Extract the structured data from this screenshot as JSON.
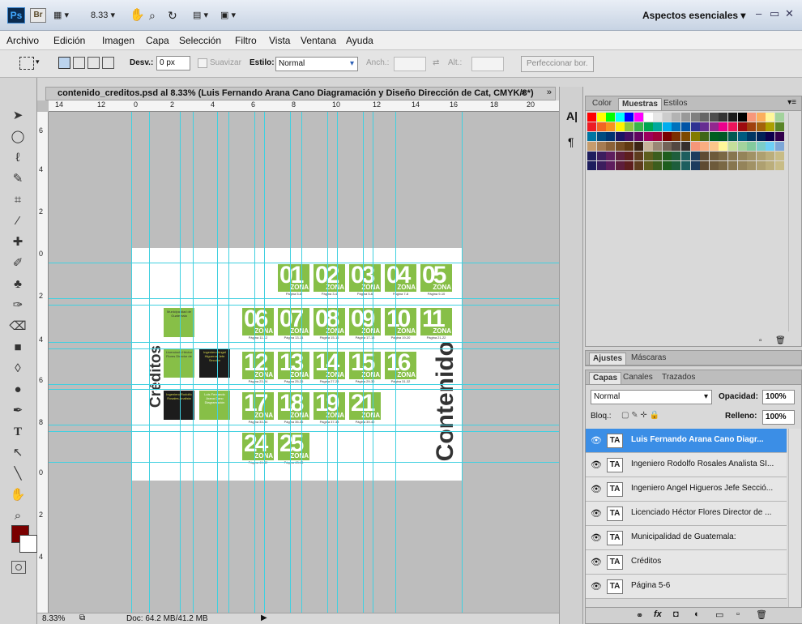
{
  "titlebar": {
    "logo": "Ps",
    "bridge": "Br",
    "zoom": "8.33",
    "workspace": "Aspectos esenciales"
  },
  "menu": [
    "Archivo",
    "Edición",
    "Imagen",
    "Capa",
    "Selección",
    "Filtro",
    "Vista",
    "Ventana",
    "Ayuda"
  ],
  "options": {
    "desv_label": "Desv.:",
    "desv_value": "0 px",
    "suavizar": "Suavizar",
    "estilo_label": "Estilo:",
    "estilo_value": "Normal",
    "anch_label": "Anch.:",
    "alt_label": "Alt.:",
    "refine": "Perfeccionar bor."
  },
  "document": {
    "tab_title": "contenido_creditos.psd al 8.33% (Luis Fernando Arana Cano Diagramación y Diseño Dirección de Cat, CMYK/8*)",
    "close": "×",
    "ruler_h": [
      "14",
      "12",
      "0",
      "2",
      "4",
      "6",
      "8",
      "10",
      "12",
      "14",
      "16",
      "18",
      "20"
    ],
    "ruler_v": [
      "6",
      "4",
      "2",
      "0",
      "2",
      "4",
      "6",
      "8",
      "0",
      "2",
      "4"
    ],
    "zone_label": "ZONA",
    "zones": [
      {
        "n": "01",
        "p": "Página 5-6"
      },
      {
        "n": "02",
        "p": "Página 3-4"
      },
      {
        "n": "03",
        "p": "Página 5-6"
      },
      {
        "n": "04",
        "p": "Página 7-8"
      },
      {
        "n": "05",
        "p": "Página 9-10"
      },
      {
        "n": "06",
        "p": "Página 11-12"
      },
      {
        "n": "07",
        "p": "Página 13-14"
      },
      {
        "n": "08",
        "p": "Página 15-16"
      },
      {
        "n": "09",
        "p": "Página 17-18"
      },
      {
        "n": "10",
        "p": "Página 19-20"
      },
      {
        "n": "11",
        "p": "Página 21-22"
      },
      {
        "n": "12",
        "p": "Página 23-24"
      },
      {
        "n": "13",
        "p": "Página 25-26"
      },
      {
        "n": "14",
        "p": "Página 27-28"
      },
      {
        "n": "15",
        "p": "Página 29-30"
      },
      {
        "n": "16",
        "p": "Página 31-32"
      },
      {
        "n": "17",
        "p": "Página 33-34"
      },
      {
        "n": "18",
        "p": "Página 35-36"
      },
      {
        "n": "19",
        "p": "Página 37-38"
      },
      {
        "n": "21",
        "p": "Página 39-40"
      },
      {
        "n": "24",
        "p": "Página 41-42"
      },
      {
        "n": "25",
        "p": "Página 43-44"
      }
    ],
    "creditos": "Créditos",
    "contenido": "Contenido",
    "credit_boxes": [
      "Municipalidad de Guatemala",
      "Licenciado Héctor Flores Director de",
      "Ingeniero Angel Higueros Jefe Sección",
      "Ingeniero Rodolfo Rosales Analista",
      "Luis Fernando Arana Cano Diagramación"
    ]
  },
  "status": {
    "zoom": "8.33%",
    "doc": "Doc: 64.2 MB/41.2 MB"
  },
  "colors": {
    "zone_green": "#87bf47",
    "guide": "#40d0e0",
    "selected": "#3b8ee6"
  },
  "swatch_panel": {
    "tabs": [
      "Color",
      "Muestras",
      "Estilos"
    ],
    "active": "Muestras"
  },
  "adjust_panel": {
    "tabs": [
      "Ajustes",
      "Máscaras"
    ]
  },
  "layers_panel": {
    "tabs": [
      "Capas",
      "Canales",
      "Trazados"
    ],
    "blend": "Normal",
    "opacity_label": "Opacidad:",
    "opacity": "100%",
    "lock_label": "Bloq.:",
    "fill_label": "Relleno:",
    "fill": "100%",
    "layers": [
      "Luis Fernando Arana Cano Diagr...",
      "Ingeniero  Rodolfo Rosales Analista SI...",
      "Ingeniero  Angel Higueros Jefe Secció...",
      "Licenciado  Héctor Flores Director de ...",
      "Municipalidad de  Guatemala:",
      "Créditos",
      "Página 5-6"
    ]
  }
}
